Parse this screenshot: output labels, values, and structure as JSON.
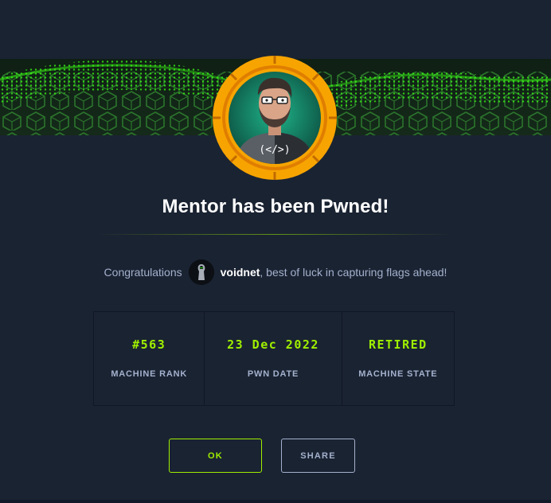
{
  "modal": {
    "title": "Mentor has been Pwned!",
    "avatar_code_text": "(</>)"
  },
  "congrats": {
    "prefix": "Congratulations",
    "username": "voidnet",
    "suffix": ", best of luck in capturing flags ahead!"
  },
  "stats": [
    {
      "value": "#563",
      "label": "MACHINE RANK"
    },
    {
      "value": "23 Dec 2022",
      "label": "PWN DATE"
    },
    {
      "value": "RETIRED",
      "label": "MACHINE STATE"
    }
  ],
  "buttons": {
    "ok_label": "OK",
    "share_label": "SHARE"
  },
  "colors": {
    "accent": "#9fef00",
    "background": "#1a2332",
    "muted_text": "#a4b1cd",
    "avatar_ring": "#f7a400"
  }
}
